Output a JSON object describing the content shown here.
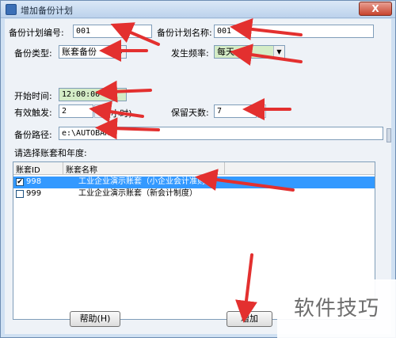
{
  "window": {
    "title": "增加备份计划",
    "close_label": "X"
  },
  "form": {
    "plan_no_label": "备份计划编号:",
    "plan_no_value": "001",
    "plan_name_label": "备份计划名称:",
    "plan_name_value": "001",
    "backup_type_label": "备份类型:",
    "backup_type_value": "账套备份",
    "frequency_label": "发生频率:",
    "frequency_value": "每天",
    "start_time_label": "开始时间:",
    "start_time_value": "12:00:00",
    "trigger_label": "有效触发:",
    "trigger_value": "2",
    "trigger_unit": "(小时)",
    "keep_days_label": "保留天数:",
    "keep_days_value": "7",
    "path_label": "备份路径:",
    "path_value": "e:\\AUTOBAK\\",
    "select_label": "请选择账套和年度:"
  },
  "table": {
    "columns": [
      "账套ID",
      "账套名称"
    ],
    "rows": [
      {
        "id": "998",
        "name": "工业企业演示账套（小企业会计准则）",
        "checked": true,
        "selected": true
      },
      {
        "id": "999",
        "name": "工业企业演示账套（新会计制度）",
        "checked": false,
        "selected": false
      }
    ]
  },
  "buttons": {
    "help": "帮助(H)",
    "add": "增加"
  },
  "watermark": "软件技巧",
  "colors": {
    "annotation_arrow": "#e3302f",
    "selection": "#3399ff",
    "start_time_field": "#d4ecc6"
  }
}
